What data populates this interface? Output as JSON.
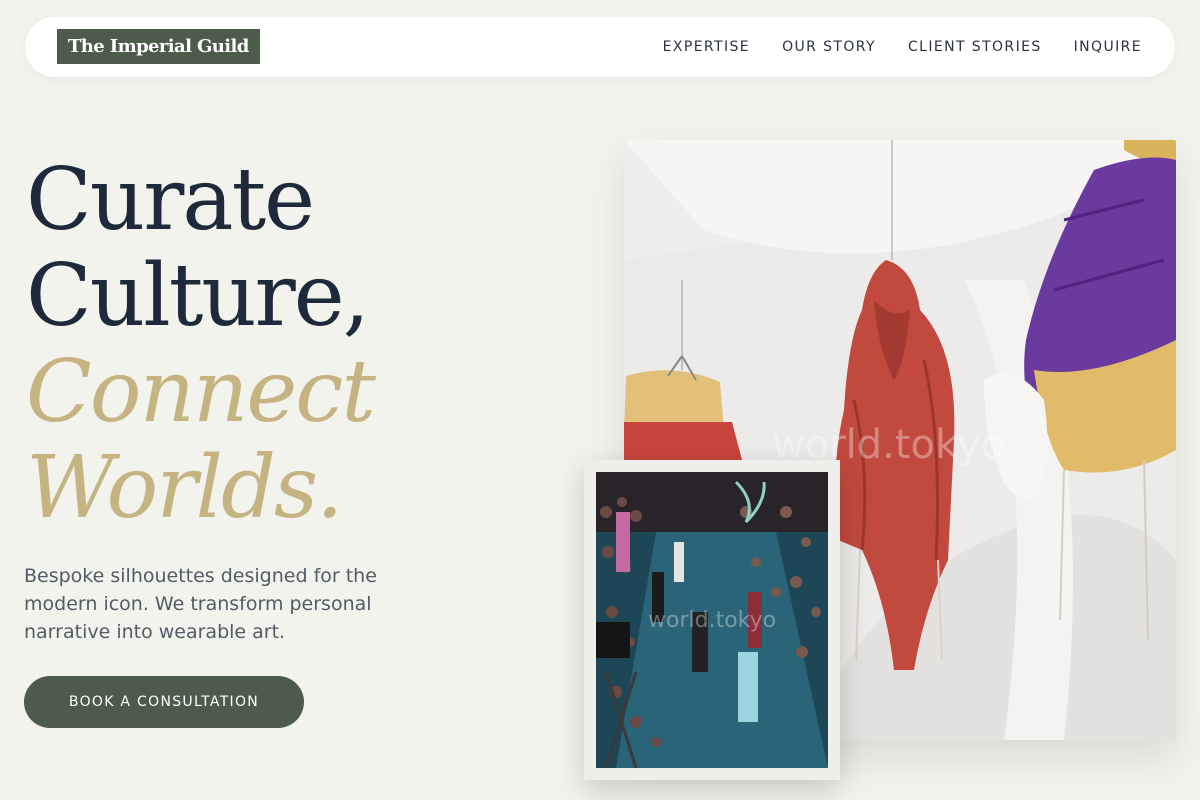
{
  "brand": {
    "name": "The Imperial Guild"
  },
  "nav": {
    "links": [
      "EXPERTISE",
      "OUR STORY",
      "CLIENT STORIES",
      "INQUIRE"
    ]
  },
  "hero": {
    "title_line1": "Curate",
    "title_line2": "Culture,",
    "title_line3": "Connect",
    "title_line4": "Worlds.",
    "subtitle": "Bespoke silhouettes designed for the modern icon. We transform personal narrative into wearable art.",
    "cta_label": "BOOK A CONSULTATION"
  },
  "images": {
    "main_watermark": "world.tokyo",
    "small_watermark": "world.tokyo"
  },
  "colors": {
    "background": "#f3f3ee",
    "accent_green": "#4d5b4b",
    "accent_gold": "#c5b482",
    "heading_navy": "#1e2a3c"
  }
}
